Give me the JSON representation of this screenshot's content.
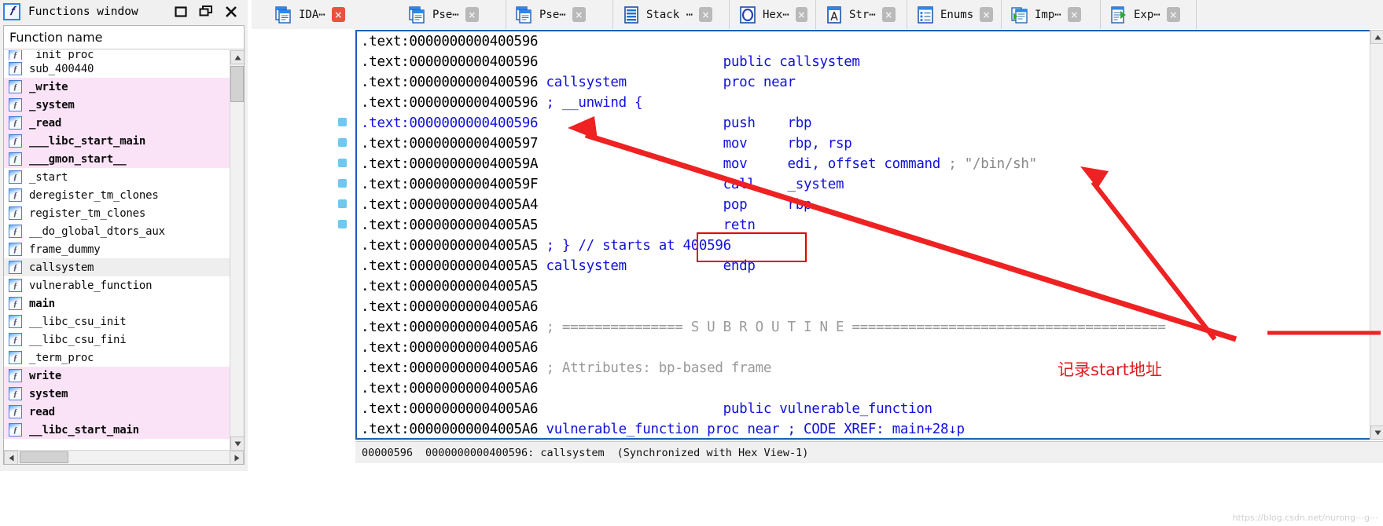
{
  "functions_window": {
    "title": "Functions window",
    "title_icon": "function-f-icon",
    "buttons": [
      {
        "name": "maximize-button",
        "glyph": "maximize-icon"
      },
      {
        "name": "restore-button",
        "glyph": "restore-icon"
      },
      {
        "name": "close-button",
        "glyph": "close-icon"
      }
    ],
    "column_header": "Function name",
    "items": [
      {
        "label": "_init_proc",
        "state": "clipped"
      },
      {
        "label": "sub_400440",
        "state": "normal"
      },
      {
        "label": "_write",
        "state": "pink-bold"
      },
      {
        "label": "_system",
        "state": "pink-bold"
      },
      {
        "label": "_read",
        "state": "pink-bold"
      },
      {
        "label": "___libc_start_main",
        "state": "pink-bold"
      },
      {
        "label": "___gmon_start__",
        "state": "pink-bold"
      },
      {
        "label": "_start",
        "state": "normal"
      },
      {
        "label": "deregister_tm_clones",
        "state": "normal"
      },
      {
        "label": "register_tm_clones",
        "state": "normal"
      },
      {
        "label": "__do_global_dtors_aux",
        "state": "normal"
      },
      {
        "label": "frame_dummy",
        "state": "normal"
      },
      {
        "label": "callsystem",
        "state": "selected"
      },
      {
        "label": "vulnerable_function",
        "state": "normal"
      },
      {
        "label": "main",
        "state": "bold"
      },
      {
        "label": "__libc_csu_init",
        "state": "normal"
      },
      {
        "label": "__libc_csu_fini",
        "state": "normal"
      },
      {
        "label": "_term_proc",
        "state": "normal"
      },
      {
        "label": "write",
        "state": "pink-bold"
      },
      {
        "label": "system",
        "state": "pink-bold"
      },
      {
        "label": "read",
        "state": "pink-bold"
      },
      {
        "label": "__libc_start_main",
        "state": "pink-bold"
      }
    ]
  },
  "tabs": [
    {
      "label": "IDA⋯",
      "icon": "ida-view-icon",
      "close": "close-icon",
      "active": true
    },
    {
      "label": "Pse⋯",
      "icon": "pseudocode-icon",
      "close": "close-icon",
      "active": false
    },
    {
      "label": "Pse⋯",
      "icon": "pseudocode-icon",
      "close": "close-icon",
      "active": false
    },
    {
      "label": "Stack ⋯",
      "icon": "stack-icon",
      "close": "close-icon",
      "active": false
    },
    {
      "label": "Hex⋯",
      "icon": "hex-view-icon",
      "close": "close-icon",
      "active": false
    },
    {
      "label": "Str⋯",
      "icon": "strings-icon",
      "close": "close-icon",
      "active": false
    },
    {
      "label": "Enums",
      "icon": "enums-icon",
      "close": "close-icon",
      "active": false
    },
    {
      "label": "Imp⋯",
      "icon": "imports-icon",
      "close": "close-icon",
      "active": false
    },
    {
      "label": "Exp⋯",
      "icon": "exports-icon",
      "close": "close-icon",
      "active": false
    }
  ],
  "disassembly": {
    "lines": [
      {
        "addr": ".text:0000000000400596",
        "seg1": "",
        "seg2": "",
        "highlight": false,
        "bp": false
      },
      {
        "addr": ".text:0000000000400596",
        "seg1": "",
        "seg2": "public callsystem",
        "highlight": false,
        "bp": false
      },
      {
        "addr": ".text:0000000000400596",
        "seg1": "callsystem",
        "seg2": "proc near",
        "highlight": false,
        "bp": false
      },
      {
        "addr": ".text:0000000000400596",
        "seg1": "; __unwind {",
        "seg2": "",
        "highlight": false,
        "bp": false
      },
      {
        "addr": ".text:0000000000400596",
        "seg1": "",
        "seg2": "push    rbp",
        "highlight": true,
        "bp": true
      },
      {
        "addr": ".text:0000000000400597",
        "seg1": "",
        "seg2": "mov     rbp, rsp",
        "highlight": false,
        "bp": true
      },
      {
        "addr": ".text:000000000040059A",
        "seg1": "",
        "seg2": "mov     edi, offset command ; \"/bin/sh\"",
        "highlight": false,
        "bp": true
      },
      {
        "addr": ".text:000000000040059F",
        "seg1": "",
        "seg2": "call    _system",
        "highlight": false,
        "bp": true
      },
      {
        "addr": ".text:00000000004005A4",
        "seg1": "",
        "seg2": "pop     rbp",
        "highlight": false,
        "bp": true
      },
      {
        "addr": ".text:00000000004005A5",
        "seg1": "",
        "seg2": "retn",
        "highlight": false,
        "bp": true
      },
      {
        "addr": ".text:00000000004005A5",
        "seg1": "; } // starts at 400596",
        "seg2": "",
        "highlight": false,
        "bp": false
      },
      {
        "addr": ".text:00000000004005A5",
        "seg1": "callsystem",
        "seg2": "endp",
        "highlight": false,
        "bp": false
      },
      {
        "addr": ".text:00000000004005A5",
        "seg1": "",
        "seg2": "",
        "highlight": false,
        "bp": false
      },
      {
        "addr": ".text:00000000004005A6",
        "seg1": "",
        "seg2": "",
        "highlight": false,
        "bp": false
      },
      {
        "addr": ".text:00000000004005A6",
        "seg1": "; =============== S U B R O U T I N E =======================================",
        "seg2": "",
        "highlight": false,
        "bp": false
      },
      {
        "addr": ".text:00000000004005A6",
        "seg1": "",
        "seg2": "",
        "highlight": false,
        "bp": false
      },
      {
        "addr": ".text:00000000004005A6",
        "seg1": "; Attributes: bp-based frame",
        "seg2": "",
        "highlight": false,
        "bp": false
      },
      {
        "addr": ".text:00000000004005A6",
        "seg1": "",
        "seg2": "",
        "highlight": false,
        "bp": false
      },
      {
        "addr": ".text:00000000004005A6",
        "seg1": "",
        "seg2": "public vulnerable_function",
        "highlight": false,
        "bp": false
      },
      {
        "addr": ".text:00000000004005A6",
        "seg1": "vulnerable_function proc near",
        "seg2": "; CODE XREF: main+28↓p",
        "highlight": false,
        "bp": false
      }
    ]
  },
  "status_bar": {
    "offset": "00000596",
    "location": "0000000000400596: callsystem",
    "sync": "(Synchronized with Hex View-1)"
  },
  "annotations": {
    "note_text": "记录start地址",
    "red_box_target": "at 400596",
    "arrow_color": "#ee2222"
  },
  "watermark": "https://blog.csdn.net/nurong⋯g⋯"
}
